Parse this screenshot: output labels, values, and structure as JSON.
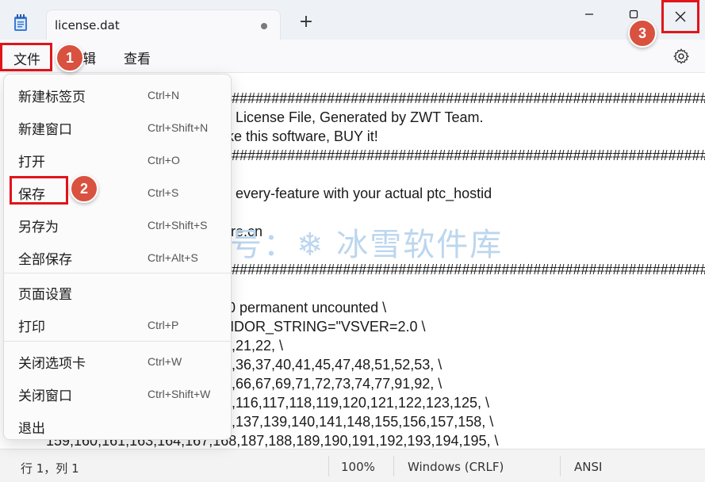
{
  "window": {
    "tab_title": "license.dat",
    "new_tab": "+"
  },
  "menubar": {
    "file": "文件",
    "edit_partial": "辑",
    "view": "查看"
  },
  "dropdown": {
    "items": [
      {
        "label": "新建标签页",
        "shortcut": "Ctrl+N"
      },
      {
        "label": "新建窗口",
        "shortcut": "Ctrl+Shift+N"
      },
      {
        "label": "打开",
        "shortcut": "Ctrl+O"
      },
      {
        "label": "保存",
        "shortcut": "Ctrl+S"
      },
      {
        "label": "另存为",
        "shortcut": "Ctrl+Shift+S"
      },
      {
        "label": "全部保存",
        "shortcut": "Ctrl+Alt+S"
      },
      {
        "label": "页面设置",
        "shortcut": ""
      },
      {
        "label": "打印",
        "shortcut": "Ctrl+P"
      },
      {
        "label": "关闭选项卡",
        "shortcut": "Ctrl+W"
      },
      {
        "label": "关闭窗口",
        "shortcut": "Ctrl+Shift+W"
      },
      {
        "label": "退出",
        "shortcut": ""
      }
    ]
  },
  "editor": {
    "lines": [
      "##############################################################",
      "0 License File, Generated by ZWT Team.",
      "ike this software, BUY it!",
      "##############################################################",
      "n every-feature with your actual ptc_hostid",
      "fire.cn",
      "##############################################################",
      ".0 permanent uncounted \\",
      "NDOR_STRING=\"VSVER=2.0 \\",
      "9,21,22, \\",
      "5,36,37,40,41,45,47,48,51,52,53, \\",
      "5,66,67,69,71,72,73,74,77,91,92, \\",
      "5,116,117,118,119,120,121,122,123,125, \\",
      "5,137,139,140,141,148,155,156,157,158, \\",
      "159,160,161,163,164,167,168,187,188,189,190,191,192,193,194,195, \\"
    ]
  },
  "watermark": "公众号：❄ 冰雪软件库",
  "statusbar": {
    "position": "行 1，列 1",
    "zoom": "100%",
    "line_ending": "Windows (CRLF)",
    "encoding": "ANSI"
  },
  "badges": [
    "1",
    "2",
    "3"
  ],
  "colors": {
    "highlight": "#e1141b",
    "badge": "#d9513f"
  },
  "icons": {
    "app": "notepad-icon",
    "minimize": "minimize-icon",
    "maximize": "maximize-icon",
    "close": "close-icon",
    "settings": "gear-icon"
  }
}
